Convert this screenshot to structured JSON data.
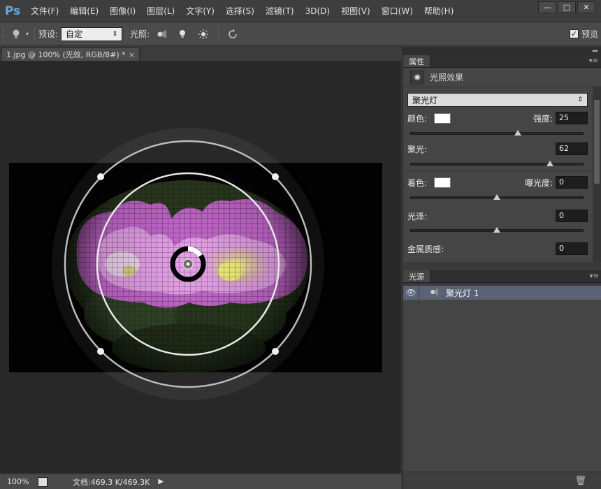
{
  "app": {
    "logo": "Ps"
  },
  "menu": [
    "文件(F)",
    "编辑(E)",
    "图像(I)",
    "图层(L)",
    "文字(Y)",
    "选择(S)",
    "滤镜(T)",
    "3D(D)",
    "视图(V)",
    "窗口(W)",
    "帮助(H)"
  ],
  "window_controls": {
    "minimize": "—",
    "maximize": "□",
    "close": "✕"
  },
  "options": {
    "preset_label": "预设:",
    "preset_value": "自定",
    "lights_label": "光照:",
    "preview_label": "预览",
    "preview_checked": true
  },
  "document": {
    "tab_title": "1.jpg @ 100% (光效, RGB/8#) *",
    "close": "×"
  },
  "status": {
    "zoom": "100%",
    "doc_info": "文档:469.3 K/469.3K"
  },
  "properties": {
    "tab": "属性",
    "title": "光照效果",
    "light_type": "聚光灯",
    "color_label": "颜色:",
    "color_value": "#ffffff",
    "intensity_label": "强度:",
    "intensity_value": "25",
    "hotspot_label": "聚光:",
    "hotspot_value": "62",
    "colorize_label": "着色:",
    "exposure_label": "曝光度:",
    "exposure_value": "0",
    "gloss_label": "光泽:",
    "gloss_value": "0",
    "metallic_label": "金属质感:",
    "metallic_value": "0"
  },
  "lights_panel": {
    "tab": "光源",
    "items": [
      {
        "name": "聚光灯 1",
        "visible": true
      }
    ]
  },
  "icons": {
    "bulb": "bulb-icon",
    "spot": "spotlight-icon",
    "point": "point-light-icon",
    "infinite": "infinite-light-icon",
    "reset": "reset-icon",
    "eye": "eye-icon",
    "trash": "trash-icon"
  }
}
